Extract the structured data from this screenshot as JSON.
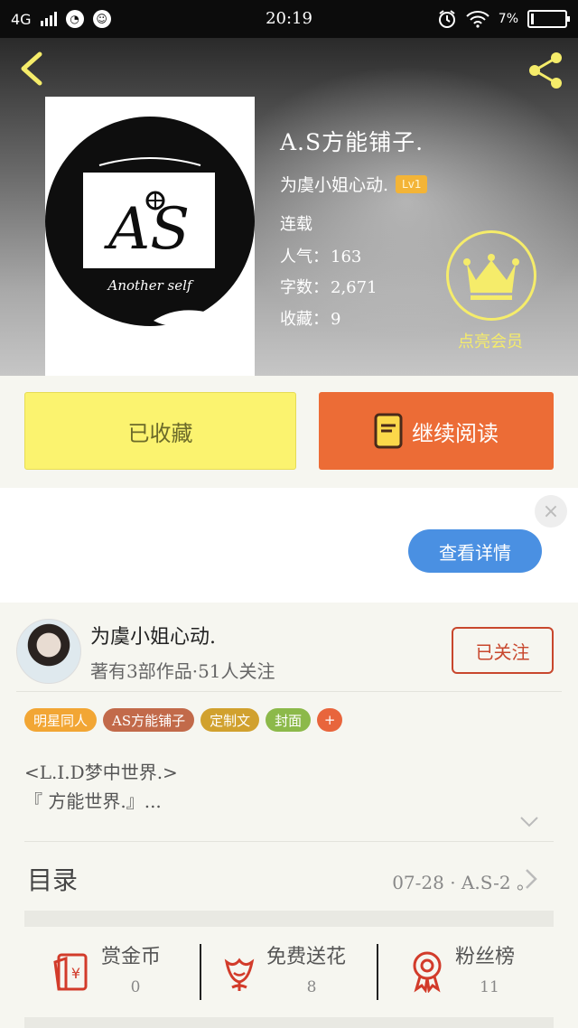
{
  "status_bar": {
    "network": "4G",
    "time": "20:19",
    "battery": "7%",
    "battery_level": 0.07
  },
  "book": {
    "title": "A.S方能铺子.",
    "author": "为虞小姐心动.",
    "author_level": "Lv1",
    "status": "连载",
    "popularity_label": "人气：",
    "popularity": "163",
    "word_count_label": "字数：",
    "word_count": "2,671",
    "favorites_label": "收藏：",
    "favorites": "9",
    "cover": {
      "logo_text": "AS",
      "caption": "Another self"
    }
  },
  "vip": {
    "label": "点亮会员",
    "icon": "crown-icon"
  },
  "actions": {
    "collected_label": "已收藏",
    "continue_label": "继续阅读",
    "continue_icon": "book-icon"
  },
  "ad": {
    "detail_label": "查看详情",
    "close_icon": "close-icon"
  },
  "author_card": {
    "name": "为虞小姐心动.",
    "stats": "著有3部作品·51人关注",
    "follow_label": "已关注"
  },
  "tags": [
    {
      "label": "明星同人",
      "color": "#f2a634"
    },
    {
      "label": "AS方能铺子",
      "color": "#c26a4a"
    },
    {
      "label": "定制文",
      "color": "#d1a12e"
    },
    {
      "label": "封面",
      "color": "#8cb94a"
    },
    {
      "label": "+",
      "color": "#e8653c"
    }
  ],
  "intro": {
    "line1": "<L.I.D梦中世界.>",
    "line2": "『 方能世界.』..."
  },
  "toc": {
    "label": "目录",
    "latest": "07-28 · A.S-2 。"
  },
  "stats": [
    {
      "label": "赏金币",
      "value": "0",
      "icon": "red-envelope-icon"
    },
    {
      "label": "免费送花",
      "value": "8",
      "icon": "flower-icon"
    },
    {
      "label": "粉丝榜",
      "value": "11",
      "icon": "medal-icon"
    }
  ],
  "colors": {
    "accent_orange": "#ec6c36",
    "collected_yellow": "#fbf36f",
    "follow_red": "#c8472d",
    "detail_blue": "#4a90e2",
    "vip_yellow": "#f5ec6a"
  }
}
